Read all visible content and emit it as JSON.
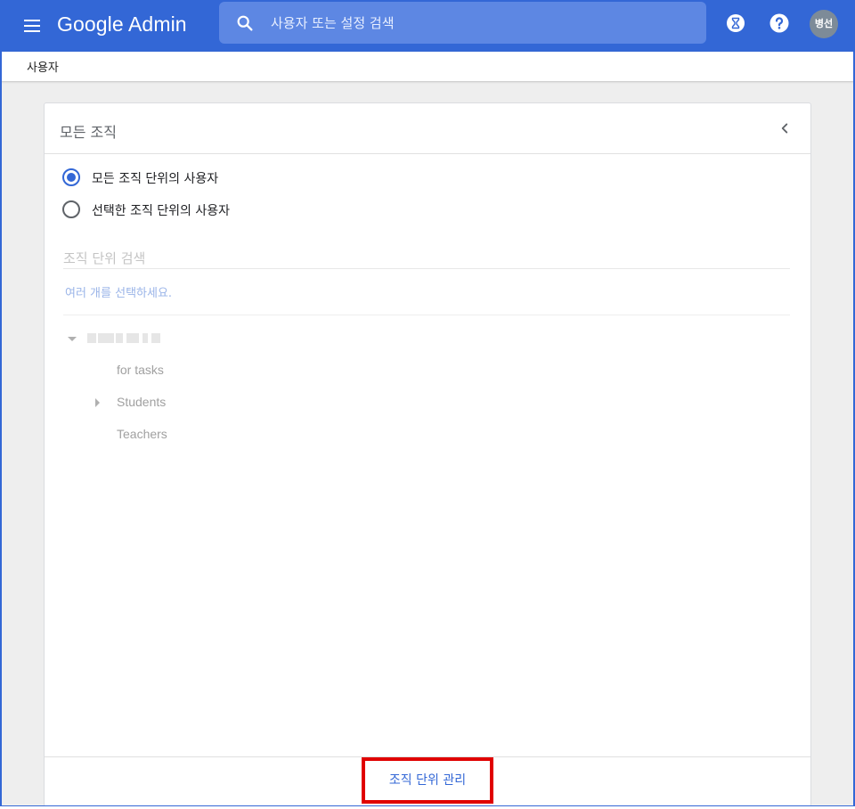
{
  "app": {
    "title": "Google Admin",
    "search_placeholder": "사용자 또는 설정 검색",
    "avatar_initials": "병선",
    "brand_color": "#3367d6"
  },
  "icons": {
    "menu": "hamburger-menu-icon",
    "search": "search-icon",
    "support": "hourglass-icon",
    "help": "help-icon",
    "collapse": "chevron-left-icon"
  },
  "breadcrumb": {
    "current": "사용자"
  },
  "panel": {
    "title": "모든 조직",
    "radio_options": [
      {
        "label": "모든 조직 단위의 사용자",
        "checked": true
      },
      {
        "label": "선택한 조직 단위의 사용자",
        "checked": false
      }
    ],
    "search_placeholder": "조직 단위 검색",
    "hint": "여러 개를 선택하세요.",
    "tree": {
      "root_label": "",
      "children": [
        {
          "label": "for tasks",
          "expandable": false
        },
        {
          "label": "Students",
          "expandable": true
        },
        {
          "label": "Teachers",
          "expandable": false
        }
      ]
    },
    "manage_button": "조직 단위 관리"
  }
}
